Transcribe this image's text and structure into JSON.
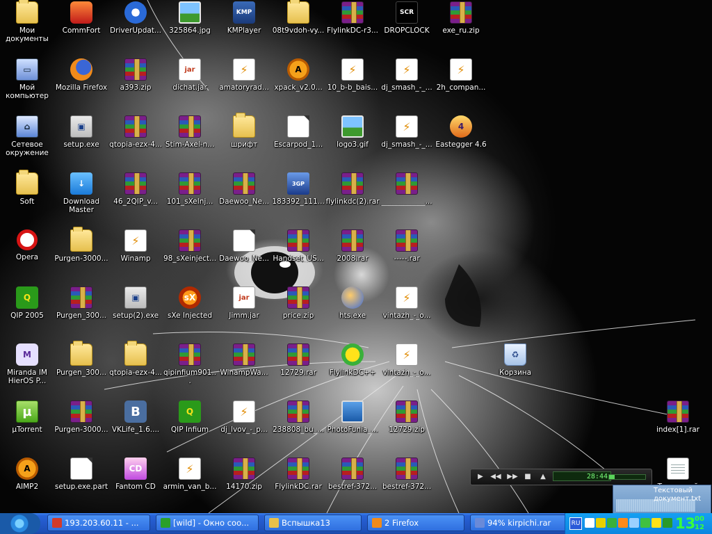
{
  "desktop": {
    "icons": [
      {
        "label": "Мои документы",
        "kind": "folder",
        "col": 0,
        "row": 0
      },
      {
        "label": "Мой компьютер",
        "kind": "computer",
        "col": 0,
        "row": 1
      },
      {
        "label": "Сетевое окружение",
        "kind": "net",
        "col": 0,
        "row": 2
      },
      {
        "label": "Soft",
        "kind": "folder",
        "col": 0,
        "row": 3
      },
      {
        "label": "Opera",
        "kind": "opera",
        "col": 0,
        "row": 4
      },
      {
        "label": "QIP 2005",
        "kind": "qip",
        "col": 0,
        "row": 5
      },
      {
        "label": "Miranda IM HierOS P...",
        "kind": "miranda",
        "col": 0,
        "row": 6
      },
      {
        "label": "µTorrent",
        "kind": "utorrent",
        "col": 0,
        "row": 7
      },
      {
        "label": "AIMP2",
        "kind": "aimp",
        "col": 0,
        "row": 8
      },
      {
        "label": "CommFort",
        "kind": "comm",
        "col": 1,
        "row": 0
      },
      {
        "label": "Mozilla Firefox",
        "kind": "firefox",
        "col": 1,
        "row": 1
      },
      {
        "label": "setup.exe",
        "kind": "exe",
        "col": 1,
        "row": 2
      },
      {
        "label": "Download Master",
        "kind": "dm",
        "col": 1,
        "row": 3
      },
      {
        "label": "Purgen-3000...",
        "kind": "folder",
        "col": 1,
        "row": 4
      },
      {
        "label": "Purgen_300...",
        "kind": "archive",
        "col": 1,
        "row": 5
      },
      {
        "label": "Purgen_300...",
        "kind": "folder",
        "col": 1,
        "row": 6
      },
      {
        "label": "Purgen-3000...",
        "kind": "archive",
        "col": 1,
        "row": 7
      },
      {
        "label": "setup.exe.part",
        "kind": "doc",
        "col": 1,
        "row": 8
      },
      {
        "label": "DriverUpdat...",
        "kind": "driver",
        "col": 2,
        "row": 0
      },
      {
        "label": "a393.zip",
        "kind": "archive",
        "col": 2,
        "row": 1
      },
      {
        "label": "qtopia-ezx-4...",
        "kind": "archive",
        "col": 2,
        "row": 2
      },
      {
        "label": "46_2QIP_v...",
        "kind": "archive",
        "col": 2,
        "row": 3
      },
      {
        "label": "Winamp",
        "kind": "winamp",
        "col": 2,
        "row": 4
      },
      {
        "label": "setup(2).exe",
        "kind": "exe",
        "col": 2,
        "row": 5
      },
      {
        "label": "qtopia-ezx-4...",
        "kind": "folder",
        "col": 2,
        "row": 6
      },
      {
        "label": "VKLife_1.6....",
        "kind": "vk",
        "col": 2,
        "row": 7
      },
      {
        "label": "Fantom CD",
        "kind": "cd",
        "col": 2,
        "row": 8
      },
      {
        "label": "325864.jpg",
        "kind": "image",
        "col": 3,
        "row": 0
      },
      {
        "label": "dichat.jar",
        "kind": "java",
        "col": 3,
        "row": 1
      },
      {
        "label": "Stim-Axel-n...",
        "kind": "archive",
        "col": 3,
        "row": 2
      },
      {
        "label": "101_sXeInj...",
        "kind": "archive",
        "col": 3,
        "row": 3
      },
      {
        "label": "98_sXeinject...",
        "kind": "archive",
        "col": 3,
        "row": 4
      },
      {
        "label": "sXe Injected",
        "kind": "sxe",
        "col": 3,
        "row": 5
      },
      {
        "label": "qipinfium901...",
        "kind": "archive",
        "col": 3,
        "row": 6
      },
      {
        "label": "QIP Infium",
        "kind": "qip",
        "col": 3,
        "row": 7
      },
      {
        "label": "armin_van_b...",
        "kind": "winamp",
        "col": 3,
        "row": 8
      },
      {
        "label": "KMPlayer",
        "kind": "kmp",
        "col": 4,
        "row": 0
      },
      {
        "label": "amatoryrad...",
        "kind": "winamp",
        "col": 4,
        "row": 1
      },
      {
        "label": "шрифт",
        "kind": "folder",
        "col": 4,
        "row": 2
      },
      {
        "label": "Daewoo_Ne...",
        "kind": "archive",
        "col": 4,
        "row": 3
      },
      {
        "label": "Daewoo_Ne...",
        "kind": "doc",
        "col": 4,
        "row": 4
      },
      {
        "label": "Jimm.jar",
        "kind": "java",
        "col": 4,
        "row": 5
      },
      {
        "label": "WinampWa...",
        "kind": "archive",
        "col": 4,
        "row": 6
      },
      {
        "label": "dj_lvov_-_p...",
        "kind": "winamp",
        "col": 4,
        "row": 7
      },
      {
        "label": "14170.zip",
        "kind": "archive",
        "col": 4,
        "row": 8
      },
      {
        "label": "08t9vdoh-vy...",
        "kind": "folder",
        "col": 5,
        "row": 0
      },
      {
        "label": "xpack_v2.0...",
        "kind": "aimp",
        "col": 5,
        "row": 1
      },
      {
        "label": "Escarpod_1...",
        "kind": "doc",
        "col": 5,
        "row": 2
      },
      {
        "label": "183392_111...",
        "kind": "3gp",
        "col": 5,
        "row": 3
      },
      {
        "label": "Handset_US...",
        "kind": "archive",
        "col": 5,
        "row": 4
      },
      {
        "label": "price.zip",
        "kind": "archive",
        "col": 5,
        "row": 5
      },
      {
        "label": "12729.rar",
        "kind": "archive",
        "col": 5,
        "row": 6
      },
      {
        "label": "238808_bu_...",
        "kind": "archive",
        "col": 5,
        "row": 7
      },
      {
        "label": "FlylinkDC.rar",
        "kind": "archive",
        "col": 5,
        "row": 8
      },
      {
        "label": "FlylinkDC-r3...",
        "kind": "archive",
        "col": 6,
        "row": 0
      },
      {
        "label": "10_b-b_bais...",
        "kind": "winamp",
        "col": 6,
        "row": 1
      },
      {
        "label": "logo3.gif",
        "kind": "image",
        "col": 6,
        "row": 2
      },
      {
        "label": "flylinkdc(2).rar",
        "kind": "archive",
        "col": 6,
        "row": 3
      },
      {
        "label": "2008.rar",
        "kind": "archive",
        "col": 6,
        "row": 4
      },
      {
        "label": "hts.exe",
        "kind": "hts",
        "col": 6,
        "row": 5
      },
      {
        "label": "FlylinkDC++",
        "kind": "flylink",
        "col": 6,
        "row": 6
      },
      {
        "label": "PhotoFunia_...",
        "kind": "photo",
        "col": 6,
        "row": 7
      },
      {
        "label": "bestref-372...",
        "kind": "archive",
        "col": 6,
        "row": 8
      },
      {
        "label": "DROPCLOCK",
        "kind": "clock",
        "col": 7,
        "row": 0
      },
      {
        "label": "dj_smash_-_...",
        "kind": "winamp",
        "col": 7,
        "row": 1
      },
      {
        "label": "dj_smash_-_...",
        "kind": "winamp",
        "col": 7,
        "row": 2
      },
      {
        "label": "____________...",
        "kind": "archive",
        "col": 7,
        "row": 3
      },
      {
        "label": "-----.rar",
        "kind": "archive",
        "col": 7,
        "row": 4
      },
      {
        "label": "vintazh_-_o...",
        "kind": "winamp",
        "col": 7,
        "row": 5
      },
      {
        "label": "vintazh_-_o...",
        "kind": "winamp",
        "col": 7,
        "row": 6
      },
      {
        "label": "12729.zip",
        "kind": "archive",
        "col": 7,
        "row": 7
      },
      {
        "label": "bestref-372...",
        "kind": "archive",
        "col": 7,
        "row": 8
      },
      {
        "label": "exe_ru.zip",
        "kind": "archive",
        "col": 8,
        "row": 0
      },
      {
        "label": "2h_compan...",
        "kind": "winamp",
        "col": 8,
        "row": 1
      },
      {
        "label": "Eastegger 4.6",
        "kind": "easter",
        "col": 8,
        "row": 2
      },
      {
        "label": "Корзина",
        "kind": "trash",
        "col": 9,
        "row": 6
      },
      {
        "label": "index[1].rar",
        "kind": "archive",
        "col": 12,
        "row": 7
      },
      {
        "label": "Текстовый документ.txt",
        "kind": "txt",
        "col": 12,
        "row": 8
      }
    ],
    "glyphs": {
      "opera": "",
      "qip": "Q",
      "utorrent": "µ",
      "aimp": "A",
      "vk": "B",
      "miranda": "M",
      "kmp": "KMP",
      "clock": "SCR",
      "java": "jar",
      "dm": "↓",
      "cd": "CD",
      "net": "⌂",
      "computer": "▭",
      "exe": "▣",
      "sxe": "sX",
      "easter": "4",
      "3gp": "3GP",
      "winamp": "⚡",
      "trash": "♻"
    }
  },
  "player": {
    "time": "28:44",
    "volume": 0.15
  },
  "popup": {
    "text": "Текстовый документ.txt"
  },
  "taskbar": {
    "tasks": [
      {
        "label": "193.203.60.11 - ...",
        "icon_color": "#d23a2a"
      },
      {
        "label": "[wild] - Окно соо...",
        "icon_color": "#2aa02a"
      },
      {
        "label": "Вспышка13",
        "icon_color": "#e8c04a"
      },
      {
        "label": "2 Firefox",
        "icon_color": "#f08a1a"
      },
      {
        "label": "94% kirpichi.rar",
        "icon_color": "#6a8ad8"
      }
    ],
    "tray": {
      "lang": "RU",
      "clock_hour": "13",
      "clock_min1": "00",
      "clock_min2": "12",
      "icon_colors": [
        "#ffffff",
        "#e8d000",
        "#3ab03a",
        "#ff8a1a",
        "#9ad0ff",
        "#40c040",
        "#ffe21a",
        "#2a9a2a"
      ]
    }
  },
  "colors": {
    "taskbar": "#245edb",
    "tray": "#0f8ee6",
    "clock": "#3aff3a"
  }
}
